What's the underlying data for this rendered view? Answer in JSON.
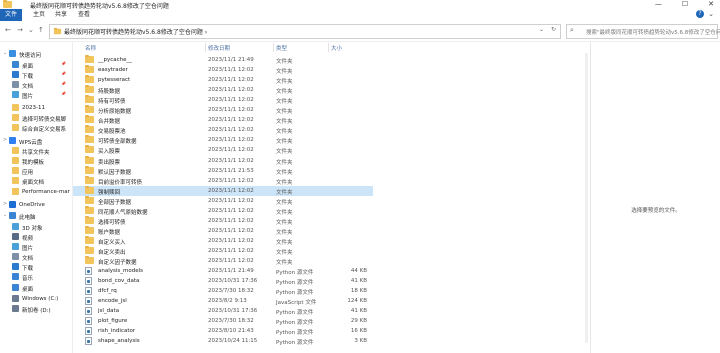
{
  "window": {
    "title": "最终版同花顺可转债趋势轮动v5.6.8修改了空仓问题",
    "minimize": "—",
    "maximize": "☐",
    "close": "✕"
  },
  "ribbon": {
    "tabs": [
      "文件",
      "主页",
      "共享",
      "查看"
    ],
    "expand": "⌄",
    "help": "?"
  },
  "address": {
    "back": "←",
    "forward": "→",
    "recent": "⌄",
    "up": "↑",
    "path": "最终版同花顺可转债趋势轮动v5.6.8修改了空仓问题  ›",
    "dropdown": "⌄",
    "refresh": "↻",
    "search_placeholder": "搜索\"最终版同花顺可转债趋势轮动v5.6.8修改了空仓问题\""
  },
  "nav": [
    {
      "label": "快速访问",
      "type": "header",
      "icon": "star",
      "color": "#3b8fe0",
      "arrow": "⌄"
    },
    {
      "label": "桌面",
      "icon": "desktop",
      "color": "#3a84d4",
      "pin": true
    },
    {
      "label": "下载",
      "icon": "download",
      "color": "#2a7bd0",
      "pin": true
    },
    {
      "label": "文档",
      "icon": "document",
      "color": "#7f8fa6",
      "pin": true
    },
    {
      "label": "图片",
      "icon": "picture",
      "color": "#4aa0d8",
      "pin": true
    },
    {
      "label": "2023-11",
      "icon": "folder",
      "color": "#f2c55c"
    },
    {
      "label": "选择可转债交易脚",
      "icon": "folder",
      "color": "#f2c55c"
    },
    {
      "label": "综合自定义交易系",
      "icon": "folder",
      "color": "#f2c55c"
    },
    {
      "label": "WPS云盘",
      "type": "header",
      "icon": "cloud",
      "color": "#2f7ff0",
      "arrow": ">"
    },
    {
      "label": "共享文件夹",
      "icon": "folder",
      "color": "#f2c55c"
    },
    {
      "label": "我的模板",
      "icon": "folder",
      "color": "#f2c55c"
    },
    {
      "label": "应用",
      "icon": "folder",
      "color": "#f2c55c"
    },
    {
      "label": "桌面文档",
      "icon": "folder",
      "color": "#f2c55c"
    },
    {
      "label": "Performance-mar",
      "icon": "folder",
      "color": "#f2c55c"
    },
    {
      "label": "OneDrive",
      "type": "header",
      "icon": "cloud",
      "color": "#1d6fd6",
      "arrow": ">"
    },
    {
      "label": "此电脑",
      "type": "header",
      "icon": "computer",
      "color": "#3a84d4",
      "arrow": "⌄"
    },
    {
      "label": "3D 对象",
      "icon": "cube",
      "color": "#4aa0d8"
    },
    {
      "label": "视频",
      "icon": "video",
      "color": "#5a6b85"
    },
    {
      "label": "图片",
      "icon": "picture",
      "color": "#4aa0d8"
    },
    {
      "label": "文档",
      "icon": "document",
      "color": "#7f8fa6"
    },
    {
      "label": "下载",
      "icon": "download",
      "color": "#2a7bd0"
    },
    {
      "label": "音乐",
      "icon": "music",
      "color": "#3a84d4"
    },
    {
      "label": "桌面",
      "icon": "desktop",
      "color": "#3a84d4"
    },
    {
      "label": "Windows (C:)",
      "icon": "drive",
      "color": "#6b7a8f"
    },
    {
      "label": "新加卷 (D:)",
      "icon": "drive",
      "color": "#6b7a8f"
    }
  ],
  "columns": {
    "name": "名称",
    "date": "修改日期",
    "type": "类型",
    "size": "大小",
    "sort_indicator": "^"
  },
  "files": [
    {
      "name": "__pycache__",
      "date": "2023/11/1 21:49",
      "type": "文件夹",
      "size": "",
      "kind": "folder"
    },
    {
      "name": "easytrader",
      "date": "2023/11/1 12:02",
      "type": "文件夹",
      "size": "",
      "kind": "folder"
    },
    {
      "name": "pytesseract",
      "date": "2023/11/1 12:02",
      "type": "文件夹",
      "size": "",
      "kind": "folder"
    },
    {
      "name": "持股数据",
      "date": "2023/11/1 12:02",
      "type": "文件夹",
      "size": "",
      "kind": "folder"
    },
    {
      "name": "持有可转债",
      "date": "2023/11/1 12:02",
      "type": "文件夹",
      "size": "",
      "kind": "folder"
    },
    {
      "name": "分析原始数据",
      "date": "2023/11/1 12:02",
      "type": "文件夹",
      "size": "",
      "kind": "folder"
    },
    {
      "name": "合并数据",
      "date": "2023/11/1 12:02",
      "type": "文件夹",
      "size": "",
      "kind": "folder"
    },
    {
      "name": "交易股票池",
      "date": "2023/11/1 12:02",
      "type": "文件夹",
      "size": "",
      "kind": "folder"
    },
    {
      "name": "可转债全部数据",
      "date": "2023/11/1 12:02",
      "type": "文件夹",
      "size": "",
      "kind": "folder"
    },
    {
      "name": "买入股票",
      "date": "2023/11/1 12:02",
      "type": "文件夹",
      "size": "",
      "kind": "folder"
    },
    {
      "name": "卖出股票",
      "date": "2023/11/1 12:02",
      "type": "文件夹",
      "size": "",
      "kind": "folder"
    },
    {
      "name": "默认因子数据",
      "date": "2023/11/1 21:53",
      "type": "文件夹",
      "size": "",
      "kind": "folder"
    },
    {
      "name": "目前溢价率可转债",
      "date": "2023/11/1 12:02",
      "type": "文件夹",
      "size": "",
      "kind": "folder"
    },
    {
      "name": "强制赎回",
      "date": "2023/11/1 12:02",
      "type": "文件夹",
      "size": "",
      "kind": "folder",
      "selected": true
    },
    {
      "name": "全部因子数据",
      "date": "2023/11/1 12:02",
      "type": "文件夹",
      "size": "",
      "kind": "folder"
    },
    {
      "name": "同花顺人气原始数据",
      "date": "2023/11/1 12:02",
      "type": "文件夹",
      "size": "",
      "kind": "folder"
    },
    {
      "name": "选择可转债",
      "date": "2023/11/1 12:02",
      "type": "文件夹",
      "size": "",
      "kind": "folder"
    },
    {
      "name": "账户数据",
      "date": "2023/11/1 12:02",
      "type": "文件夹",
      "size": "",
      "kind": "folder"
    },
    {
      "name": "自定义买入",
      "date": "2023/11/1 12:02",
      "type": "文件夹",
      "size": "",
      "kind": "folder"
    },
    {
      "name": "自定义卖出",
      "date": "2023/11/1 12:02",
      "type": "文件夹",
      "size": "",
      "kind": "folder"
    },
    {
      "name": "自定义因子数据",
      "date": "2023/11/1 12:02",
      "type": "文件夹",
      "size": "",
      "kind": "folder"
    },
    {
      "name": "analysis_models",
      "date": "2023/11/1 21:49",
      "type": "Python 源文件",
      "size": "44 KB",
      "kind": "py"
    },
    {
      "name": "bond_cov_data",
      "date": "2023/10/31 17:36",
      "type": "Python 源文件",
      "size": "41 KB",
      "kind": "py"
    },
    {
      "name": "dfcf_rq",
      "date": "2023/7/30 18:32",
      "type": "Python 源文件",
      "size": "18 KB",
      "kind": "py"
    },
    {
      "name": "encode_jsl",
      "date": "2023/8/2 9:13",
      "type": "JavaScript 文件",
      "size": "124 KB",
      "kind": "js"
    },
    {
      "name": "jsl_data",
      "date": "2023/10/31 17:36",
      "type": "Python 源文件",
      "size": "41 KB",
      "kind": "py"
    },
    {
      "name": "plot_figure",
      "date": "2023/7/30 18:32",
      "type": "Python 源文件",
      "size": "29 KB",
      "kind": "py"
    },
    {
      "name": "rish_indicator",
      "date": "2023/8/10 21:43",
      "type": "Python 源文件",
      "size": "16 KB",
      "kind": "py"
    },
    {
      "name": "shape_analysis",
      "date": "2023/10/24 11:15",
      "type": "Python 源文件",
      "size": "3 KB",
      "kind": "py"
    }
  ],
  "preview": {
    "message": "选择要预览的文件。"
  }
}
